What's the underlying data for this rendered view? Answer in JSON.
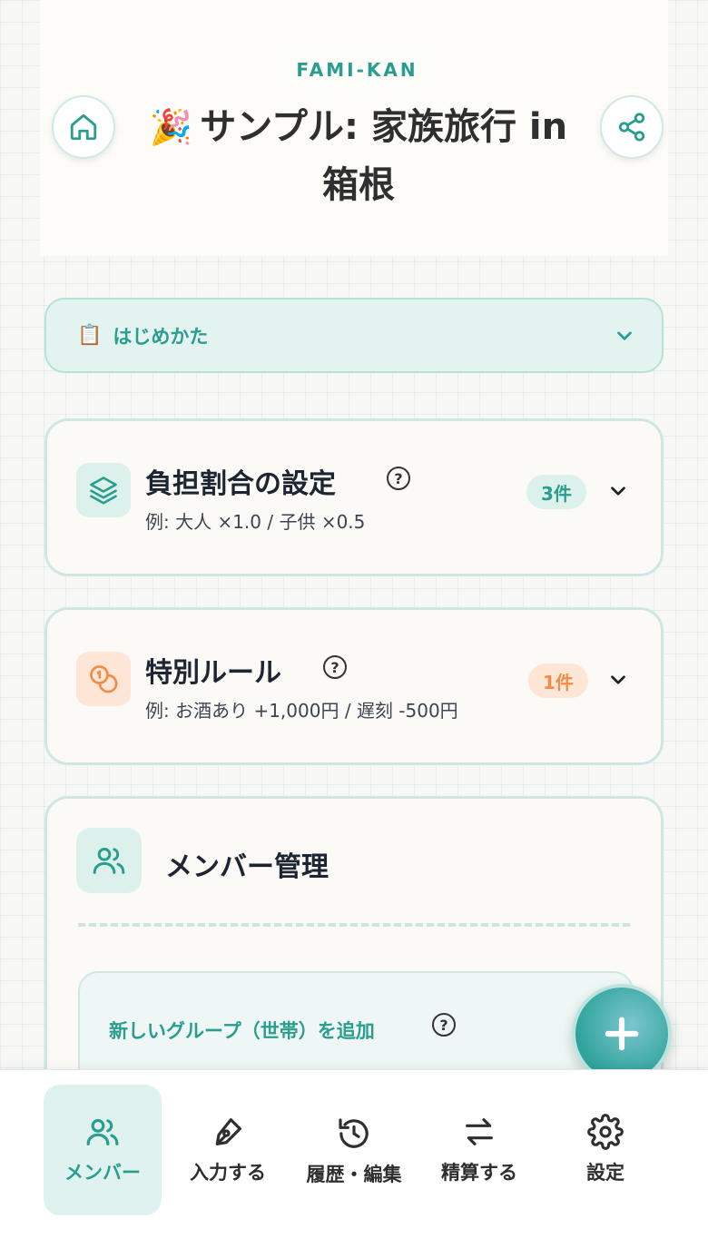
{
  "header": {
    "brand": "FAMI-KAN",
    "emoji": "🎉",
    "title": "サンプル: 家族旅行 in 箱根"
  },
  "howto": {
    "emoji": "📋",
    "label": "はじめかた"
  },
  "ratio_card": {
    "title": "負担割合の設定",
    "subtitle": "例: 大人 ×1.0 / 子供 ×0.5",
    "help": "?",
    "badge": "3件"
  },
  "rules_card": {
    "title": "特別ルール",
    "subtitle": "例: お酒あり +1,000円 / 遅刻 -500円",
    "help": "?",
    "badge": "1件"
  },
  "members_card": {
    "title": "メンバー管理",
    "group_label": "新しいグループ（世帯）を追加",
    "help": "?"
  },
  "nav": {
    "items": [
      {
        "label": "メンバー",
        "icon": "users-icon",
        "active": true
      },
      {
        "label": "入力する",
        "icon": "pen-icon",
        "active": false
      },
      {
        "label": "履歴・編集",
        "icon": "history-icon",
        "active": false
      },
      {
        "label": "精算する",
        "icon": "transfer-icon",
        "active": false
      },
      {
        "label": "設定",
        "icon": "gear-icon",
        "active": false
      }
    ]
  },
  "colors": {
    "accent": "#2a9d8f",
    "orange": "#f28c4a",
    "tint": "#e3f3f0"
  }
}
